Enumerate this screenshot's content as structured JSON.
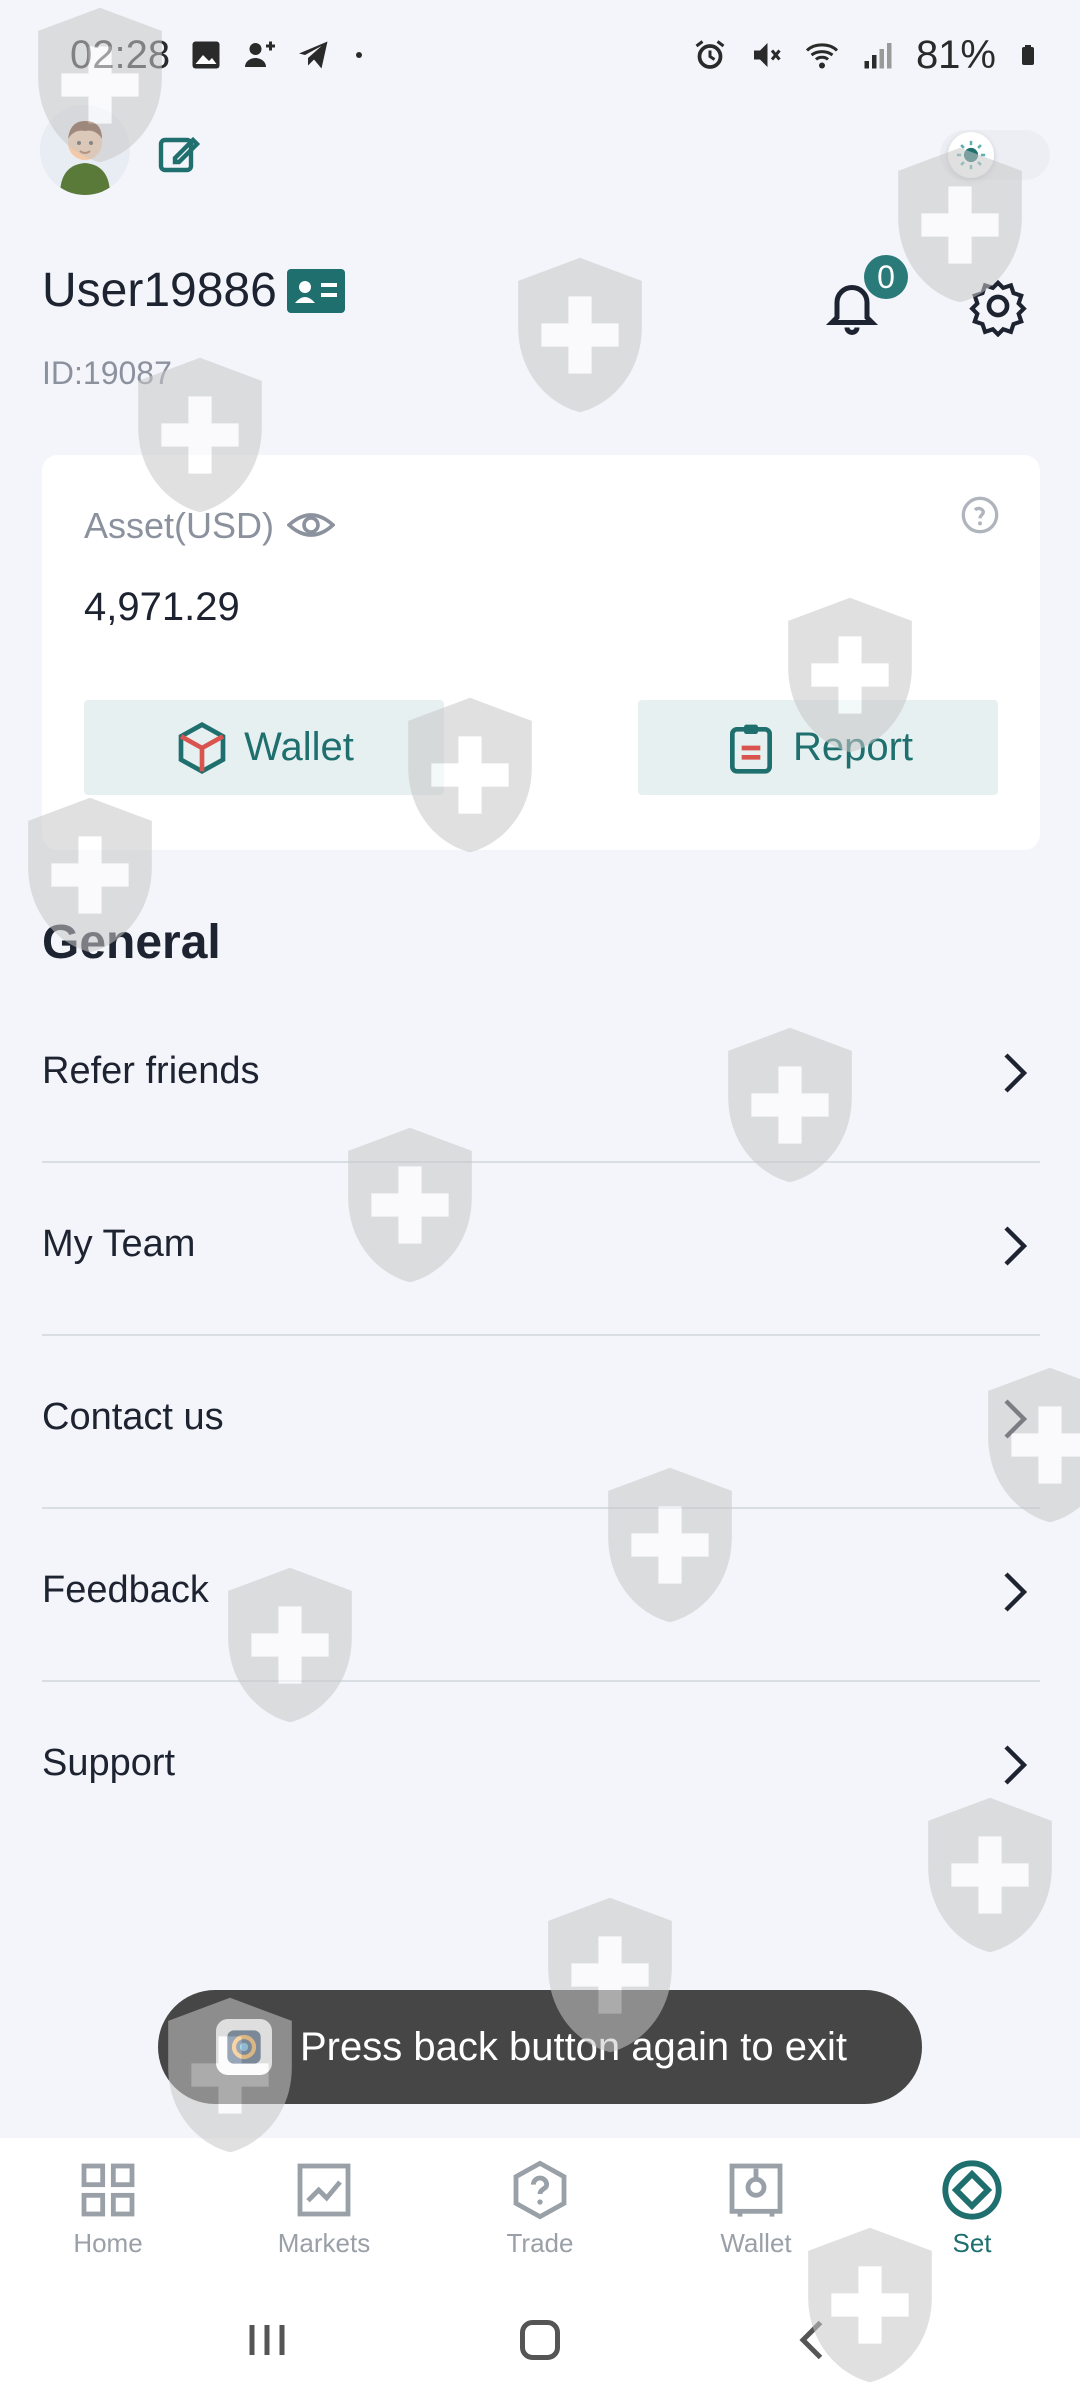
{
  "status_bar": {
    "time": "02:28",
    "battery": "81%"
  },
  "profile": {
    "username": "User19886",
    "user_id": "ID:19087",
    "notification_count": "0"
  },
  "asset_card": {
    "label": "Asset(USD)",
    "value": "4,971.29",
    "wallet_button": "Wallet",
    "report_button": "Report"
  },
  "general": {
    "title": "General",
    "items": [
      {
        "label": "Refer friends"
      },
      {
        "label": "My Team"
      },
      {
        "label": "Contact us"
      },
      {
        "label": "Feedback"
      },
      {
        "label": "Support"
      }
    ]
  },
  "toast": {
    "message": "Press back button again to exit"
  },
  "tabbar": {
    "tabs": [
      {
        "label": "Home",
        "icon": "home-grid-icon"
      },
      {
        "label": "Markets",
        "icon": "markets-chart-icon"
      },
      {
        "label": "Trade",
        "icon": "trade-question-icon"
      },
      {
        "label": "Wallet",
        "icon": "wallet-safe-icon"
      },
      {
        "label": "Set",
        "icon": "set-diamond-icon"
      }
    ],
    "active_index": 4
  },
  "colors": {
    "accent": "#1f6f6f",
    "background": "#f4f5fa",
    "card": "#ffffff",
    "toast": "#464646"
  }
}
